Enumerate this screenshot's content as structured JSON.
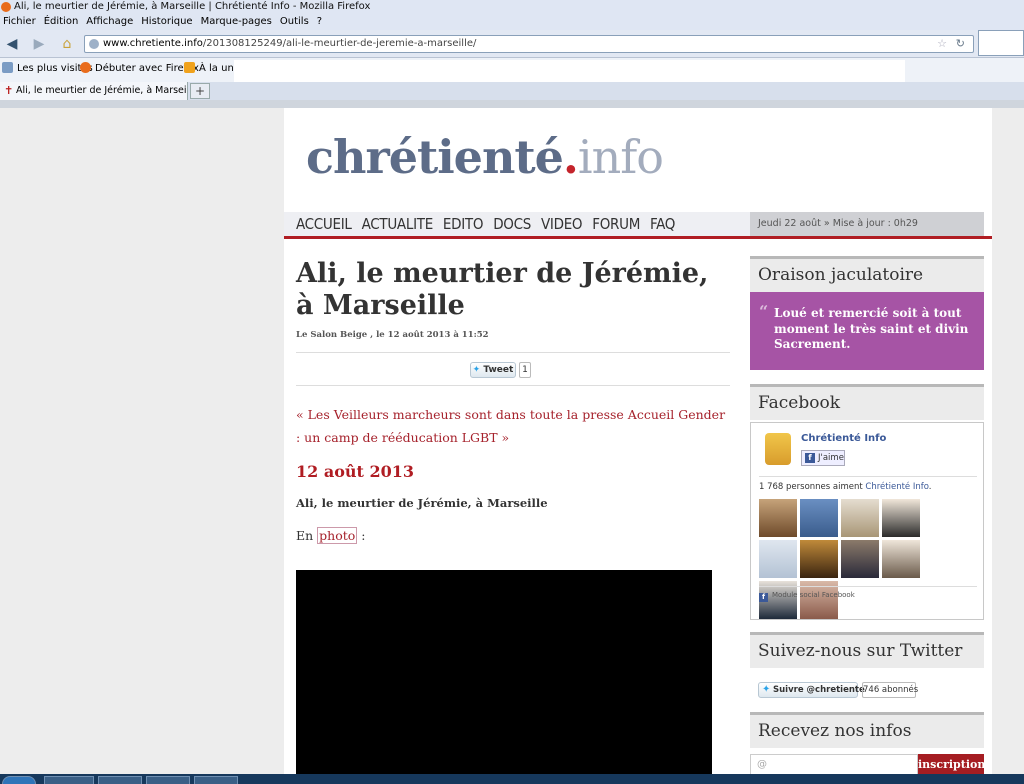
{
  "browser": {
    "window_title": "Ali, le meurtier de Jérémie, à Marseille | Chrétienté Info - Mozilla Firefox",
    "menu": [
      "Fichier",
      "Édition",
      "Affichage",
      "Historique",
      "Marque-pages",
      "Outils",
      "?"
    ],
    "url_host": "www.chretiente.info",
    "url_path": "/201308125249/ali-le-meurtier-de-jeremie-a-marseille/",
    "bookmarks": [
      "Les plus visités",
      "Débuter avec Firefox",
      "À la une"
    ],
    "tab_title": "Ali, le meurtier de Jérémie, à Marseille | ...",
    "new_tab": "+"
  },
  "site": {
    "logo_main": "chrétienté",
    "logo_dot": ".",
    "logo_tld": "info",
    "nav": [
      "ACCUEIL",
      "ACTUALITE",
      "EDITO",
      "DOCS",
      "VIDEO",
      "FORUM",
      "FAQ"
    ],
    "date_line": "Jeudi 22 août » Mise à jour : 0h29"
  },
  "article": {
    "title": "Ali, le meurtier de Jérémie, à Marseille",
    "byline": "Le Salon Beige , le 12 août 2013 à 11:52",
    "tweet_label": "Tweet",
    "tweet_count": "1",
    "related": "« Les Veilleurs marcheurs sont dans toute la presse Accueil Gender : un camp de rééducation LGBT »",
    "date_heading": "12 août 2013",
    "subtitle": "Ali, le meurtier de Jérémie, à Marseille",
    "en_text": "En",
    "photo_link": "photo",
    "colon": " :"
  },
  "sidebar": {
    "oraison_title": "Oraison jaculatoire",
    "oraison_quote_mark": "“",
    "oraison_text": "Loué et remercié soit à tout moment le très saint et divin Sacrement.",
    "facebook_title": "Facebook",
    "fb_page_name": "Chrétienté Info",
    "fb_like_label": "J'aime",
    "fb_count_text": "1 768 personnes aiment ",
    "fb_count_link": "Chrétienté Info",
    "fb_count_end": ".",
    "fb_module": "Module social Facebook",
    "twitter_title": "Suivez-nous sur Twitter",
    "twitter_follow": "Suivre @chretiente",
    "twitter_count": "746 abonnés",
    "newsletter_title": "Recevez nos infos",
    "email_placeholder": "@",
    "inscription_label": "inscription"
  },
  "colors": {
    "brand_red": "#b01d23",
    "logo_blue": "#5d6c88",
    "quote_purple": "#a654a5",
    "facebook_blue": "#3b5998"
  }
}
